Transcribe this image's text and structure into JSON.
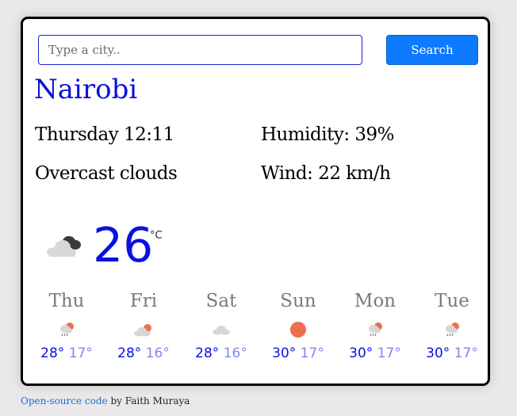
{
  "search": {
    "placeholder": "Type a city..",
    "value": "",
    "button_label": "Search"
  },
  "current": {
    "city": "Nairobi",
    "datetime": "Thursday 12:11",
    "description": "Overcast clouds",
    "humidity": "Humidity: 39%",
    "wind": "Wind: 22 km/h",
    "temperature": "26",
    "unit": "°C",
    "icon": "overcast-clouds-icon"
  },
  "forecast": [
    {
      "day": "Thu",
      "max": "28°",
      "min": "17°",
      "icon": "rain-sun-icon"
    },
    {
      "day": "Fri",
      "max": "28°",
      "min": "16°",
      "icon": "cloud-sun-icon"
    },
    {
      "day": "Sat",
      "max": "28°",
      "min": "16°",
      "icon": "cloud-icon"
    },
    {
      "day": "Sun",
      "max": "30°",
      "min": "17°",
      "icon": "sun-icon"
    },
    {
      "day": "Mon",
      "max": "30°",
      "min": "17°",
      "icon": "rain-sun-icon"
    },
    {
      "day": "Tue",
      "max": "30°",
      "min": "17°",
      "icon": "rain-sun-icon"
    }
  ],
  "footer": {
    "link_text": "Open-source code",
    "suffix": " by Faith Muraya"
  },
  "colors": {
    "accent": "#0a10e0",
    "button": "#0d7bff",
    "sun": "#ee6e4f"
  }
}
